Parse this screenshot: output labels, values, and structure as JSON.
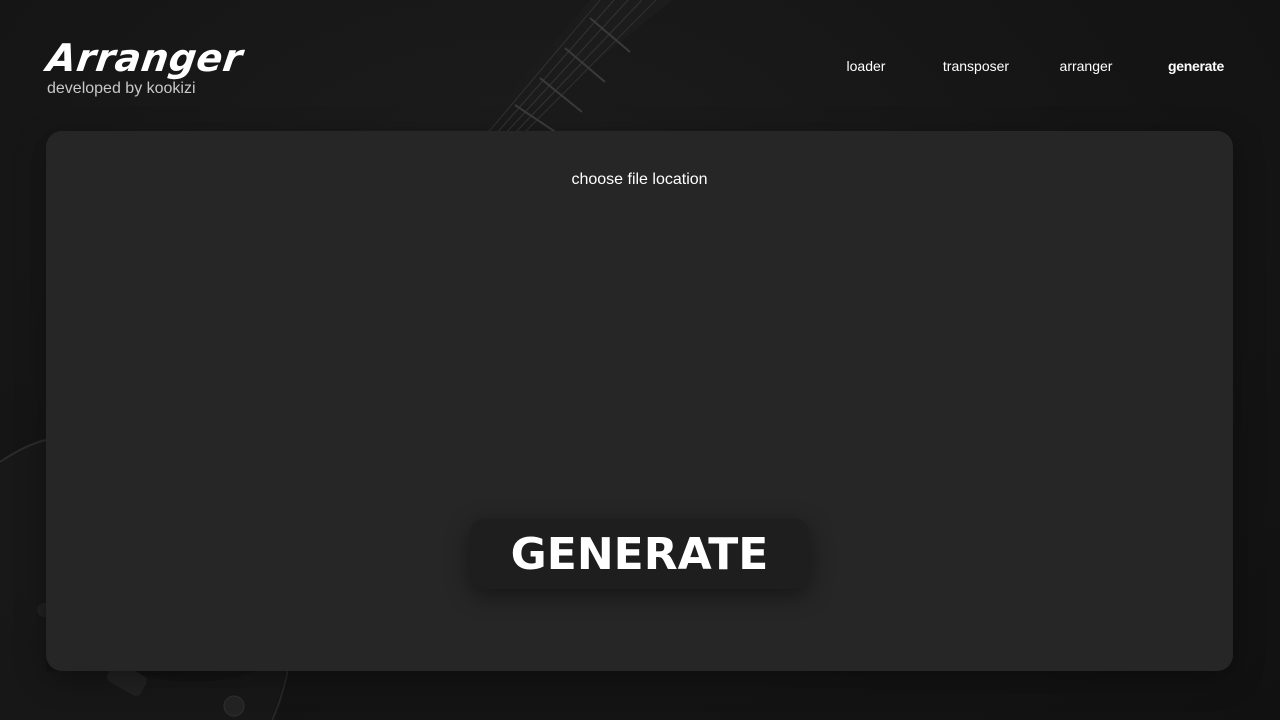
{
  "brand": {
    "title": "Arranger",
    "subtitle": "developed by kookizi"
  },
  "nav": {
    "items": [
      {
        "label": "loader",
        "active": false
      },
      {
        "label": "transposer",
        "active": false
      },
      {
        "label": "arranger",
        "active": false
      },
      {
        "label": "generate",
        "active": true
      }
    ]
  },
  "panel": {
    "file_location_label": "choose file location",
    "generate_label": "GENERATE"
  },
  "background": {
    "image": "guitar-background",
    "colors": {
      "page": "#151515",
      "panel": "#262626",
      "button": "#1e1e1e",
      "text": "#ffffff",
      "subtext": "#c8c8c8"
    }
  }
}
